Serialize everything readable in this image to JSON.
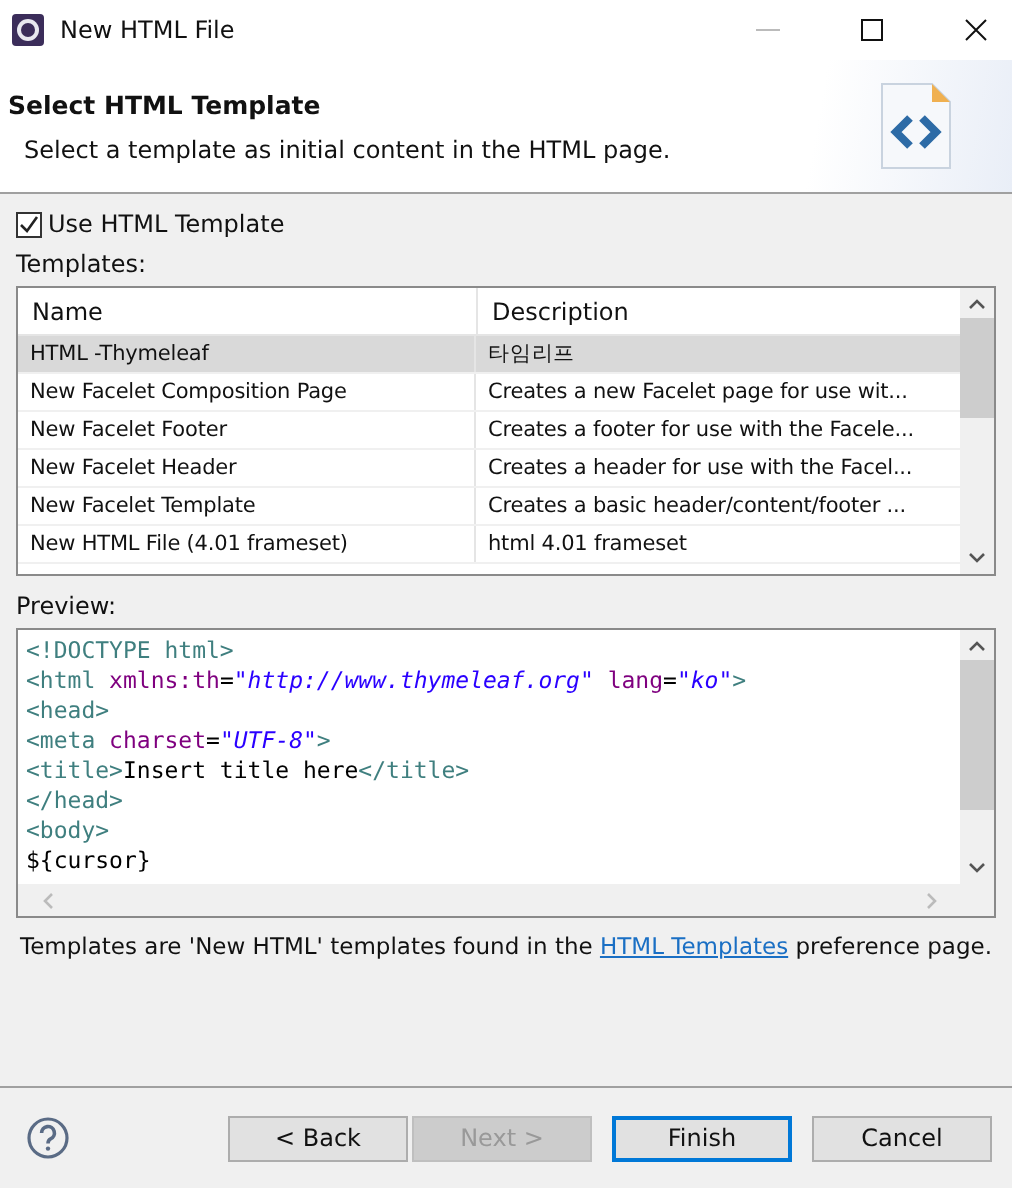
{
  "window": {
    "title": "New HTML File"
  },
  "header": {
    "title": "Select HTML Template",
    "description": "Select a template as initial content in the HTML page."
  },
  "use_template": {
    "label": "Use HTML Template",
    "checked": true
  },
  "templates": {
    "label": "Templates:",
    "columns": [
      "Name",
      "Description"
    ],
    "rows": [
      {
        "name": "HTML -Thymeleaf",
        "description": "타임리프",
        "selected": true
      },
      {
        "name": "New Facelet Composition Page",
        "description": "Creates a new Facelet page for use wit...",
        "selected": false
      },
      {
        "name": "New Facelet Footer",
        "description": "Creates a footer for use with the Facele...",
        "selected": false
      },
      {
        "name": "New Facelet Header",
        "description": "Creates a header for use with the Facel...",
        "selected": false
      },
      {
        "name": "New Facelet Template",
        "description": "Creates a basic header/content/footer ...",
        "selected": false
      },
      {
        "name": "New HTML File (4.01 frameset)",
        "description": "html 4.01 frameset",
        "selected": false
      }
    ]
  },
  "preview": {
    "label": "Preview:",
    "lines": [
      [
        {
          "kind": "tag",
          "text": "<!DOCTYPE html>"
        }
      ],
      [
        {
          "kind": "tag",
          "text": "<html"
        },
        {
          "kind": "attr",
          "text": " xmlns:th"
        },
        {
          "kind": "plain",
          "text": "="
        },
        {
          "kind": "value",
          "text": "\"http://www.thymeleaf.org\""
        },
        {
          "kind": "attr",
          "text": " lang"
        },
        {
          "kind": "plain",
          "text": "="
        },
        {
          "kind": "value",
          "text": "\"ko\""
        },
        {
          "kind": "tag",
          "text": ">"
        }
      ],
      [
        {
          "kind": "tag",
          "text": "<head>"
        }
      ],
      [
        {
          "kind": "tag",
          "text": "<meta"
        },
        {
          "kind": "attr",
          "text": " charset"
        },
        {
          "kind": "plain",
          "text": "="
        },
        {
          "kind": "value",
          "text": "\"UTF-8\""
        },
        {
          "kind": "tag",
          "text": ">"
        }
      ],
      [
        {
          "kind": "tag",
          "text": "<title>"
        },
        {
          "kind": "plain",
          "text": "Insert title here"
        },
        {
          "kind": "tag",
          "text": "</title>"
        }
      ],
      [
        {
          "kind": "tag",
          "text": "</head>"
        }
      ],
      [
        {
          "kind": "tag",
          "text": "<body>"
        }
      ],
      [
        {
          "kind": "plain",
          "text": "${cursor}"
        }
      ]
    ]
  },
  "note": {
    "before": "Templates are 'New HTML' templates found in the ",
    "link": "HTML Templates",
    "after": " preference page."
  },
  "buttons": [
    {
      "label": "< Back",
      "disabled": false,
      "default": false
    },
    {
      "label": "Next >",
      "disabled": true,
      "default": false
    },
    {
      "label": "Finish",
      "disabled": false,
      "default": true
    },
    {
      "label": "Cancel",
      "disabled": false,
      "default": false
    }
  ]
}
